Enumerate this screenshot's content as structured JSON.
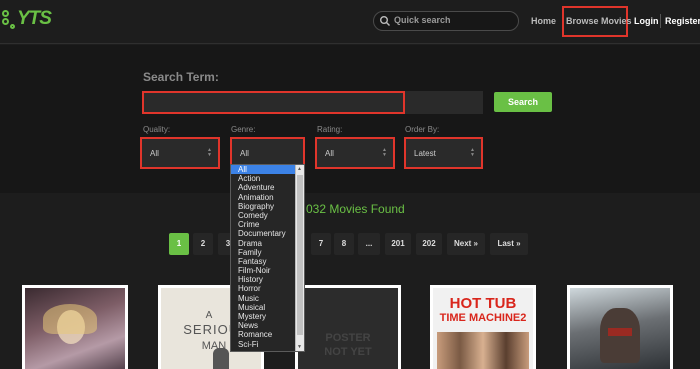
{
  "header": {
    "logo_text": "YTS",
    "search_placeholder": "Quick search",
    "nav_home": "Home",
    "nav_browse": "Browse Movies",
    "nav_login": "Login",
    "nav_register": "Register"
  },
  "search": {
    "term_label": "Search Term:",
    "term_value": "",
    "button": "Search"
  },
  "filters": {
    "quality": {
      "label": "Quality:",
      "value": "All"
    },
    "genre": {
      "label": "Genre:",
      "value": "All"
    },
    "rating": {
      "label": "Rating:",
      "value": "All"
    },
    "order_by": {
      "label": "Order By:",
      "value": "Latest"
    }
  },
  "genre_options": [
    "All",
    "Action",
    "Adventure",
    "Animation",
    "Biography",
    "Comedy",
    "Crime",
    "Documentary",
    "Drama",
    "Family",
    "Fantasy",
    "Film-Noir",
    "History",
    "Horror",
    "Music",
    "Musical",
    "Mystery",
    "News",
    "Romance",
    "Sci-Fi"
  ],
  "results": {
    "found_text": "032 Movies Found"
  },
  "pagination": {
    "pages": [
      {
        "label": "1",
        "active": true
      },
      {
        "label": "2"
      },
      {
        "label": "3"
      },
      {
        "label": "7"
      },
      {
        "label": "8"
      },
      {
        "label": "..."
      },
      {
        "label": "201"
      },
      {
        "label": "202"
      },
      {
        "label": "Next »"
      },
      {
        "label": "Last »"
      }
    ]
  },
  "posters": [
    {
      "text": ""
    },
    {
      "text_a": "A",
      "text_b": "SERIOUS",
      "text_c": "MAN"
    },
    {
      "text_a": "POSTER",
      "text_b": "NOT YET"
    },
    {
      "text_a": "HOT TUB",
      "text_b": "TIME MACHINE2"
    },
    {
      "text": ""
    }
  ],
  "colors": {
    "accent": "#6ac045",
    "highlight_box": "#e0352b",
    "selected_option": "#3c82e6"
  }
}
